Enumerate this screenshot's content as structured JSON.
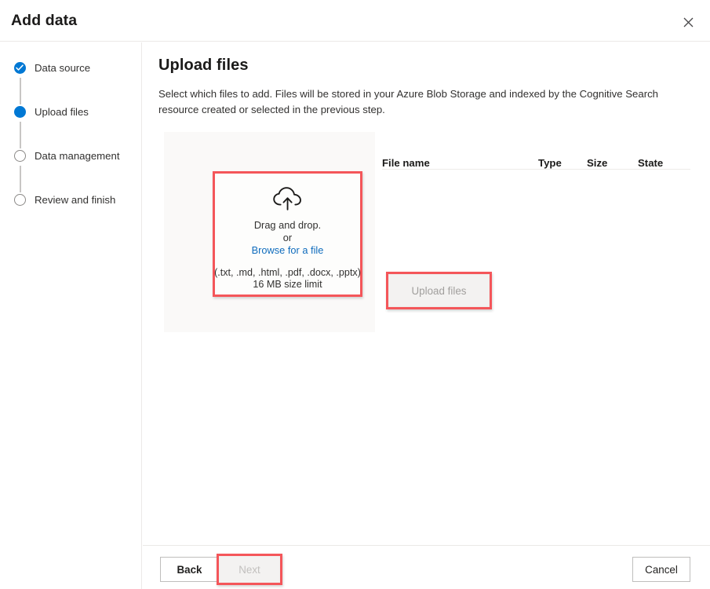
{
  "dialog": {
    "title": "Add data",
    "close_icon": "close-icon"
  },
  "sidebar": {
    "steps": [
      {
        "label": "Data source",
        "state": "done"
      },
      {
        "label": "Upload files",
        "state": "current"
      },
      {
        "label": "Data management",
        "state": "todo"
      },
      {
        "label": "Review and finish",
        "state": "todo"
      }
    ]
  },
  "main": {
    "title": "Upload files",
    "description": "Select which files to add. Files will be stored in your Azure Blob Storage and indexed by the Cognitive Search resource created or selected in the previous step.",
    "dropzone": {
      "icon": "cloud-upload-icon",
      "drag_text": "Drag and drop.",
      "or_text": "or",
      "browse_link": "Browse for a file",
      "filetypes": "(.txt, .md, .html, .pdf, .docx, .pptx)",
      "size_limit": "16 MB size limit"
    },
    "file_table": {
      "columns": [
        "File name",
        "Type",
        "Size",
        "State"
      ],
      "rows": []
    },
    "upload_button": {
      "label": "Upload files",
      "disabled": true
    }
  },
  "footer": {
    "back_label": "Back",
    "next_label": "Next",
    "cancel_label": "Cancel"
  },
  "colors": {
    "accent": "#0078d4",
    "link": "#0f6cbd",
    "annotation": "#f4565a",
    "panel_bg": "#faf9f8",
    "disabled_text": "#a19f9d"
  }
}
